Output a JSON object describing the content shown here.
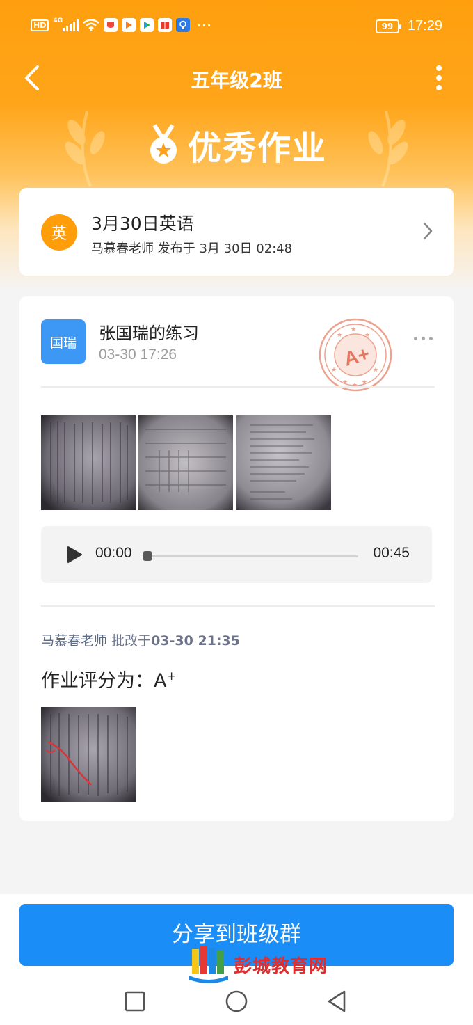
{
  "status_bar": {
    "network_badge": "HD",
    "network_type": "4G",
    "overflow": "···",
    "battery": "99",
    "time": "17:29",
    "icons": [
      "signal-icon",
      "wifi-icon",
      "app-icon-red",
      "app-icon-orange",
      "app-icon-green",
      "app-icon-book",
      "app-icon-bulb"
    ]
  },
  "nav": {
    "title": "五年级2班",
    "back_icon": "chevron-left-icon",
    "menu_icon": "more-vertical-icon"
  },
  "banner": {
    "title": "优秀作业",
    "icon": "medal-icon"
  },
  "homework": {
    "subject_badge": "英",
    "title": "3月30日英语",
    "subtitle": "马慕春老师 发布于 3月 30日 02:48"
  },
  "submission": {
    "avatar_text": "国瑞",
    "title": "张国瑞的练习",
    "time": "03-30 17:26",
    "stamp_grade": "A+",
    "photos_count": 3
  },
  "audio": {
    "current": "00:00",
    "duration": "00:45",
    "progress": 0
  },
  "review": {
    "reviewer": "马慕春老师",
    "action": " 批改于",
    "time": "03-30 21:35",
    "grade_label": "作业评分为：",
    "grade_letter": "A",
    "grade_suffix": "+"
  },
  "share_button": "分享到班级群",
  "watermark": "彭城教育网",
  "system_nav": [
    "square-icon",
    "circle-icon",
    "triangle-back-icon"
  ],
  "colors": {
    "orange": "#ff9f0e",
    "blue": "#1b8df7",
    "avatar_blue": "#3d97f5",
    "stamp": "#e8866f"
  }
}
